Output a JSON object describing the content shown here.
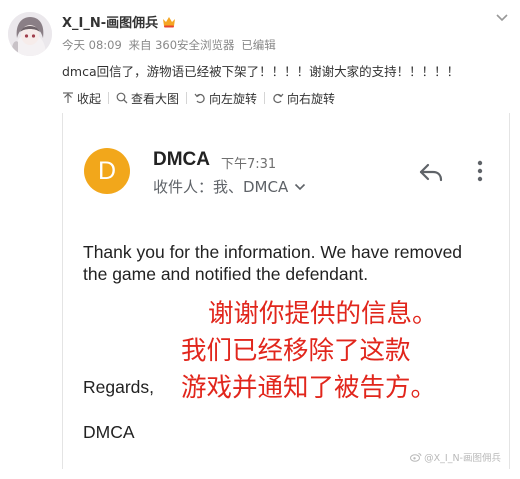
{
  "post": {
    "username": "X_I_N-画图佣兵",
    "time": "今天 08:09",
    "source": "来自 360安全浏览器",
    "edited": "已编辑",
    "text": "dmca回信了，游物语已经被下架了！！！！谢谢大家的支持！！！！！"
  },
  "toolbar": {
    "collapse_label": "收起",
    "view_large_label": "查看大图",
    "rotate_left_label": "向左旋转",
    "rotate_right_label": "向右旋转"
  },
  "email": {
    "avatar_letter": "D",
    "sender": "DMCA",
    "time": "下午7:31",
    "recipient": "收件人：我、DMCA",
    "body": "Thank you for the information.  We have removed the game and notified the defendant.",
    "regards": "Regards,",
    "signoff": "DMCA"
  },
  "overlay": {
    "line1": "谢谢你提供的信息。",
    "line2": "我们已经移除了这款",
    "line3": "游戏并通知了被告方。"
  },
  "watermark": "@X_I_N-画图佣兵",
  "colors": {
    "email_avatar_bg": "#f2a71b",
    "overlay_text": "#e1261c",
    "vip_badge": "#f5a623"
  },
  "icons": {
    "avatar": "user-avatar-image",
    "vip": "vip-crown-badge",
    "chevron": "chevron-down-icon",
    "collapse": "arrow-up-icon",
    "view_large": "magnify-icon",
    "rotate_left": "rotate-left-icon",
    "rotate_right": "rotate-right-icon",
    "reply": "reply-arrow-icon",
    "more": "more-vertical-icon",
    "watermark_logo": "weibo-logo-icon"
  }
}
